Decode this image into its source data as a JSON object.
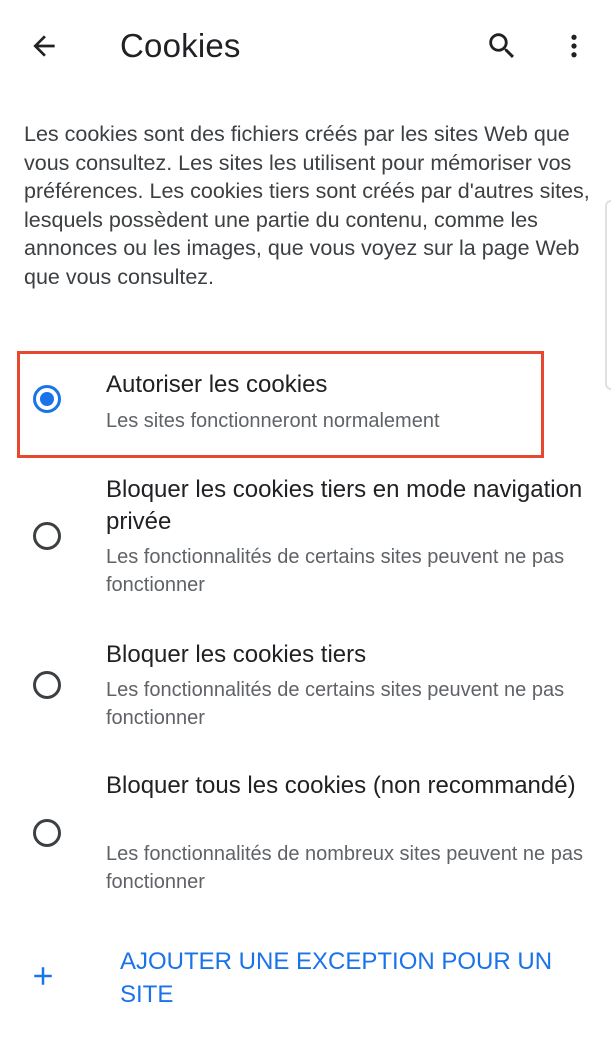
{
  "header": {
    "title": "Cookies",
    "back_icon": "arrow-back-icon",
    "search_icon": "search-icon",
    "menu_icon": "more-vert-icon"
  },
  "description": "Les cookies sont des fichiers créés par les sites Web que vous consultez. Les sites les utilisent pour mémoriser vos préférences. Les cookies tiers sont créés par d'autres sites, lesquels possèdent une partie du contenu, comme les annonces ou les images, que vous voyez sur la page Web que vous consultez.",
  "options": [
    {
      "title": "Autoriser les cookies",
      "subtitle": "Les sites fonctionneront normalement",
      "selected": true
    },
    {
      "title": "Bloquer les cookies tiers en mode navigation privée",
      "subtitle": "Les fonctionnalités de certains sites peuvent ne pas fonctionner",
      "selected": false
    },
    {
      "title": "Bloquer les cookies tiers",
      "subtitle": "Les fonctionnalités de certains sites peuvent ne pas fonctionner",
      "selected": false
    },
    {
      "title": "Bloquer tous les cookies (non recommandé)",
      "subtitle": "Les fonctionnalités de nombreux sites peuvent ne pas fonctionner",
      "selected": false
    }
  ],
  "add_exception": {
    "label": "AJOUTER UNE EXCEPTION POUR UN SITE",
    "icon": "plus-icon"
  },
  "colors": {
    "accent": "#1a73e8",
    "highlight_border": "#e8472f",
    "text_primary": "#202124",
    "text_secondary": "#5f6368"
  }
}
